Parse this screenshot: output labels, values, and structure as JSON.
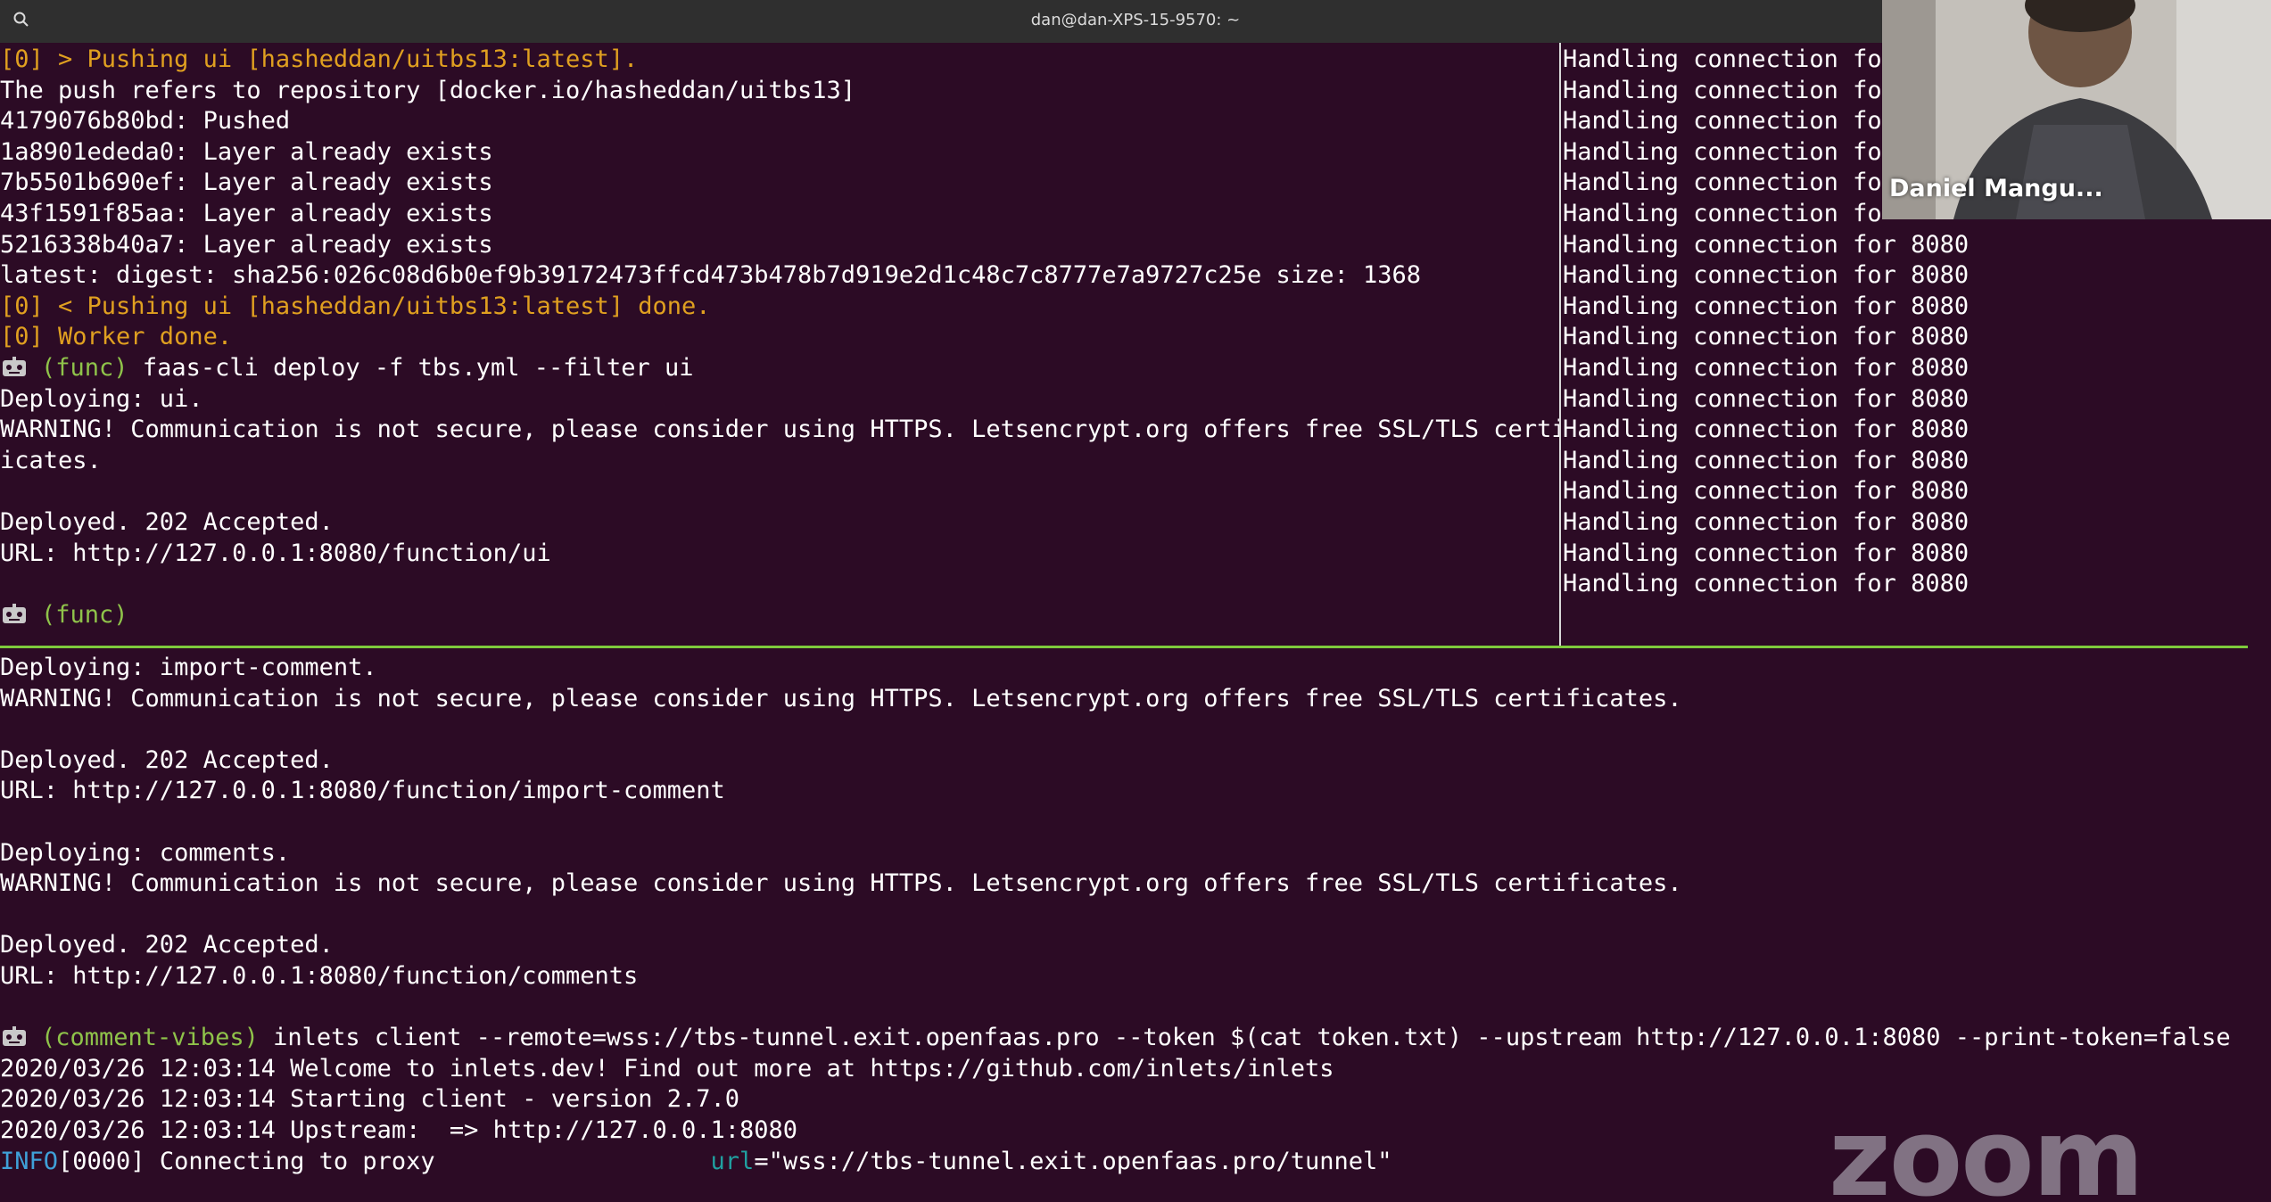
{
  "window": {
    "title": "dan@dan-XPS-15-9570: ~"
  },
  "icons": {
    "search": "search-icon",
    "prompt": "robot-icon"
  },
  "colors": {
    "background": "#2c0b25",
    "prompt_env": "#8fc34a",
    "build_log": "#e0a020",
    "divider": "#7ecb3c",
    "info": "#3fa0d8"
  },
  "top_left_pane": {
    "lines": [
      {
        "text": "[0] > Pushing ui [hasheddan/uitbs13:latest].",
        "style": "orange"
      },
      {
        "text": "The push refers to repository [docker.io/hasheddan/uitbs13]",
        "style": "plain"
      },
      {
        "text": "4179076b80bd: Pushed",
        "style": "plain"
      },
      {
        "text": "1a8901ededa0: Layer already exists",
        "style": "plain"
      },
      {
        "text": "7b5501b690ef: Layer already exists",
        "style": "plain"
      },
      {
        "text": "43f1591f85aa: Layer already exists",
        "style": "plain"
      },
      {
        "text": "5216338b40a7: Layer already exists",
        "style": "plain"
      },
      {
        "text": "latest: digest: sha256:026c08d6b0ef9b39172473ffcd473b478b7d919e2d1c48c7c8777e7a9727c25e size: 1368",
        "style": "plain"
      },
      {
        "text": "[0] < Pushing ui [hasheddan/uitbs13:latest] done.",
        "style": "orange"
      },
      {
        "text": "[0] Worker done.",
        "style": "orange"
      },
      {
        "env": "(func)",
        "cmd": "faas-cli deploy -f tbs.yml --filter ui",
        "style": "prompt"
      },
      {
        "text": "Deploying: ui.",
        "style": "plain"
      },
      {
        "text": "WARNING! Communication is not secure, please consider using HTTPS. Letsencrypt.org offers free SSL/TLS certif",
        "style": "plain"
      },
      {
        "text": "icates.",
        "style": "plain"
      },
      {
        "text": "",
        "style": "plain"
      },
      {
        "text": "Deployed. 202 Accepted.",
        "style": "plain"
      },
      {
        "text": "URL: http://127.0.0.1:8080/function/ui",
        "style": "plain"
      },
      {
        "text": "",
        "style": "plain"
      },
      {
        "env": "(func)",
        "cmd": "",
        "style": "prompt"
      }
    ]
  },
  "top_right_pane": {
    "lines": [
      "Handling connection fo",
      "Handling connection fo",
      "Handling connection fo",
      "Handling connection fo",
      "Handling connection fo",
      "Handling connection fo",
      "Handling connection for 8080",
      "Handling connection for 8080",
      "Handling connection for 8080",
      "Handling connection for 8080",
      "Handling connection for 8080",
      "Handling connection for 8080",
      "Handling connection for 8080",
      "Handling connection for 8080",
      "Handling connection for 8080",
      "Handling connection for 8080",
      "Handling connection for 8080",
      "Handling connection for 8080"
    ]
  },
  "bottom_pane": {
    "lines": [
      {
        "text": "Deploying: import-comment.",
        "style": "plain"
      },
      {
        "text": "WARNING! Communication is not secure, please consider using HTTPS. Letsencrypt.org offers free SSL/TLS certificates.",
        "style": "plain"
      },
      {
        "text": "",
        "style": "plain"
      },
      {
        "text": "Deployed. 202 Accepted.",
        "style": "plain"
      },
      {
        "text": "URL: http://127.0.0.1:8080/function/import-comment",
        "style": "plain"
      },
      {
        "text": "",
        "style": "plain"
      },
      {
        "text": "Deploying: comments.",
        "style": "plain"
      },
      {
        "text": "WARNING! Communication is not secure, please consider using HTTPS. Letsencrypt.org offers free SSL/TLS certificates.",
        "style": "plain"
      },
      {
        "text": "",
        "style": "plain"
      },
      {
        "text": "Deployed. 202 Accepted.",
        "style": "plain"
      },
      {
        "text": "URL: http://127.0.0.1:8080/function/comments",
        "style": "plain"
      },
      {
        "text": "",
        "style": "plain"
      },
      {
        "env": "(comment-vibes)",
        "cmd": "inlets client --remote=wss://tbs-tunnel.exit.openfaas.pro --token $(cat token.txt) --upstream http://127.0.0.1:8080 --print-token=false",
        "style": "prompt"
      },
      {
        "text": "2020/03/26 12:03:14 Welcome to inlets.dev! Find out more at https://github.com/inlets/inlets",
        "style": "plain"
      },
      {
        "text": "2020/03/26 12:03:14 Starting client - version 2.7.0",
        "style": "plain"
      },
      {
        "text": "2020/03/26 12:03:14 Upstream:  => http://127.0.0.1:8080",
        "style": "plain"
      },
      {
        "info": "INFO",
        "rest": "[0000] Connecting to proxy",
        "key": "url",
        "val": "=\"wss://tbs-tunnel.exit.openfaas.pro/tunnel\"",
        "style": "info"
      }
    ]
  },
  "webcam": {
    "participant_name": "Daniel Mangu..."
  },
  "zoom": {
    "logo": "zoom"
  }
}
